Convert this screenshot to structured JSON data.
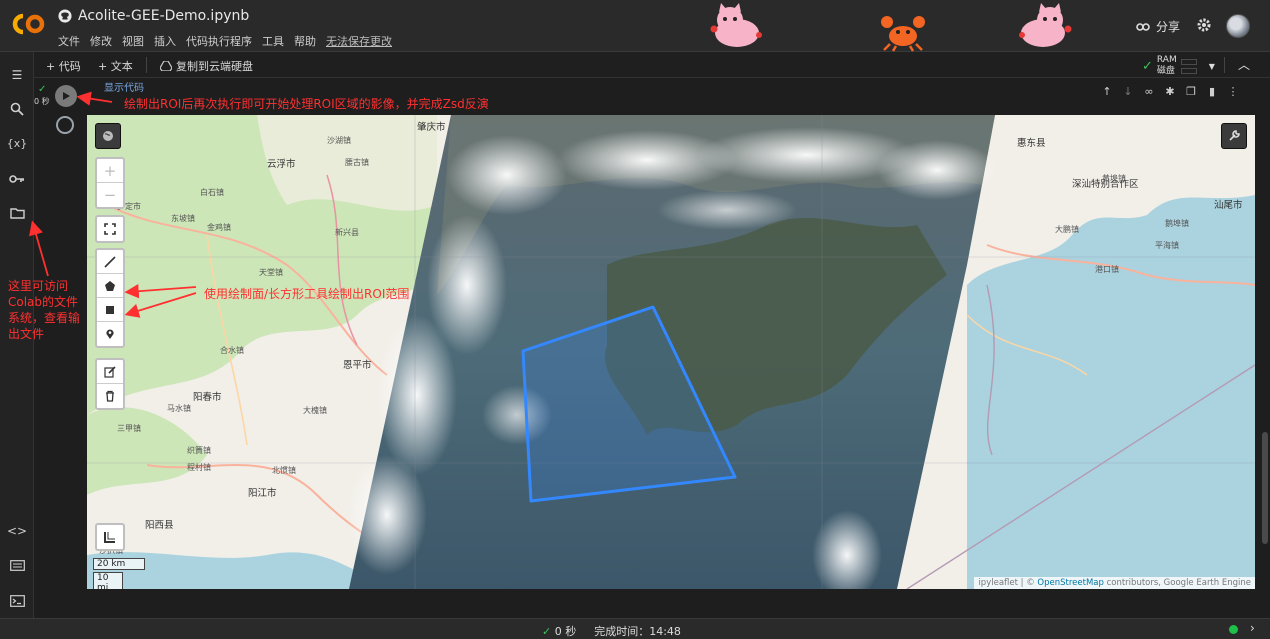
{
  "header": {
    "title": "Acolite-GEE-Demo.ipynb",
    "menu": [
      "文件",
      "修改",
      "视图",
      "插入",
      "代码执行程序",
      "工具",
      "帮助"
    ],
    "unsaved": "无法保存更改",
    "share": "分享"
  },
  "toolbar": {
    "add_code": "+ 代码",
    "add_text": "+ 文本",
    "copy_drive": "复制到云端硬盘",
    "ram": "RAM",
    "disk": "磁盘"
  },
  "cell": {
    "exec": "0 秒",
    "show_code": "显示代码"
  },
  "annotations": {
    "run": "绘制出ROI后再次执行即可开始处理ROI区域的影像，并完成Zsd反演",
    "draw": "使用绘制面/长方形工具绘制出ROI范围",
    "files": "这里可访问Colab的文件系统，查看输出文件"
  },
  "map": {
    "scale_km": "20 km",
    "scale_mi": "10 mi",
    "attribution_prefix": "ipyleaflet | © ",
    "attribution_osm": "OpenStreetMap",
    "attribution_suffix": " contributors, Google Earth Engine",
    "places": [
      {
        "name": "肇庆市",
        "c": "city"
      },
      {
        "name": "云浮市",
        "c": "city"
      },
      {
        "name": "阳春市",
        "c": "city"
      },
      {
        "name": "恩平市",
        "c": "city"
      },
      {
        "name": "阳江市",
        "c": "city"
      },
      {
        "name": "阳西县",
        "c": "city"
      },
      {
        "name": "惠东县",
        "c": "city"
      },
      {
        "name": "深汕特别合作区",
        "c": "city"
      },
      {
        "name": "汕尾市",
        "c": "city"
      },
      {
        "name": "罗定市",
        "c": ""
      },
      {
        "name": "新兴县",
        "c": ""
      },
      {
        "name": "大鹏镇",
        "c": ""
      },
      {
        "name": "港口镇",
        "c": ""
      },
      {
        "name": "鹅埠镇",
        "c": ""
      },
      {
        "name": "平海镇",
        "c": ""
      },
      {
        "name": "黄埠镇",
        "c": ""
      },
      {
        "name": "合水镇",
        "c": ""
      },
      {
        "name": "马水镇",
        "c": ""
      },
      {
        "name": "三甲镇",
        "c": ""
      },
      {
        "name": "织篢镇",
        "c": ""
      },
      {
        "name": "沙扒镇",
        "c": ""
      },
      {
        "name": "程村镇",
        "c": ""
      },
      {
        "name": "北惯镇",
        "c": ""
      },
      {
        "name": "大槐镇",
        "c": ""
      },
      {
        "name": "沙湖镇",
        "c": ""
      },
      {
        "name": "天堂镇",
        "c": ""
      },
      {
        "name": "腰古镇",
        "c": ""
      },
      {
        "name": "东坡镇",
        "c": ""
      },
      {
        "name": "白石镇",
        "c": ""
      },
      {
        "name": "金鸡镇",
        "c": ""
      }
    ]
  },
  "status": {
    "time": "0 秒",
    "done": "完成时间：14:48"
  }
}
